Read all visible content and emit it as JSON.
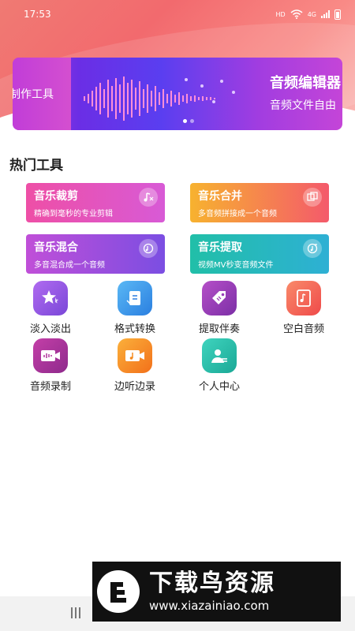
{
  "status": {
    "time": "17:53",
    "hd": "HD",
    "net": "4G"
  },
  "banner": {
    "left_text": "制作工具",
    "title": "音频编辑器",
    "subtitle": "音频文件自由"
  },
  "section": {
    "title": "热门工具"
  },
  "cards": [
    {
      "title": "音乐裁剪",
      "subtitle": "精确到毫秒的专业剪辑",
      "icon": "music-scissor-icon"
    },
    {
      "title": "音乐合并",
      "subtitle": "多音频拼接成一个音频",
      "icon": "merge-icon"
    },
    {
      "title": "音乐混合",
      "subtitle": "多音混合成一个音频",
      "icon": "mix-icon"
    },
    {
      "title": "音乐提取",
      "subtitle": "视频MV秒变音频文件",
      "icon": "extract-icon"
    }
  ],
  "tools": [
    {
      "label": "淡入淡出",
      "color": "#8a4fd9"
    },
    {
      "label": "格式转换",
      "color": "#2b8fe6"
    },
    {
      "label": "提取伴奏",
      "color": "#9a3fb8"
    },
    {
      "label": "空白音频",
      "color": "#f25a4a"
    },
    {
      "label": "音频录制",
      "color": "#b2339e"
    },
    {
      "label": "边听边录",
      "color": "#f58a1f"
    },
    {
      "label": "个人中心",
      "color": "#22b8a6"
    }
  ],
  "watermark": {
    "name": "下载鸟资源",
    "url": "www.xiazainiao.com"
  }
}
